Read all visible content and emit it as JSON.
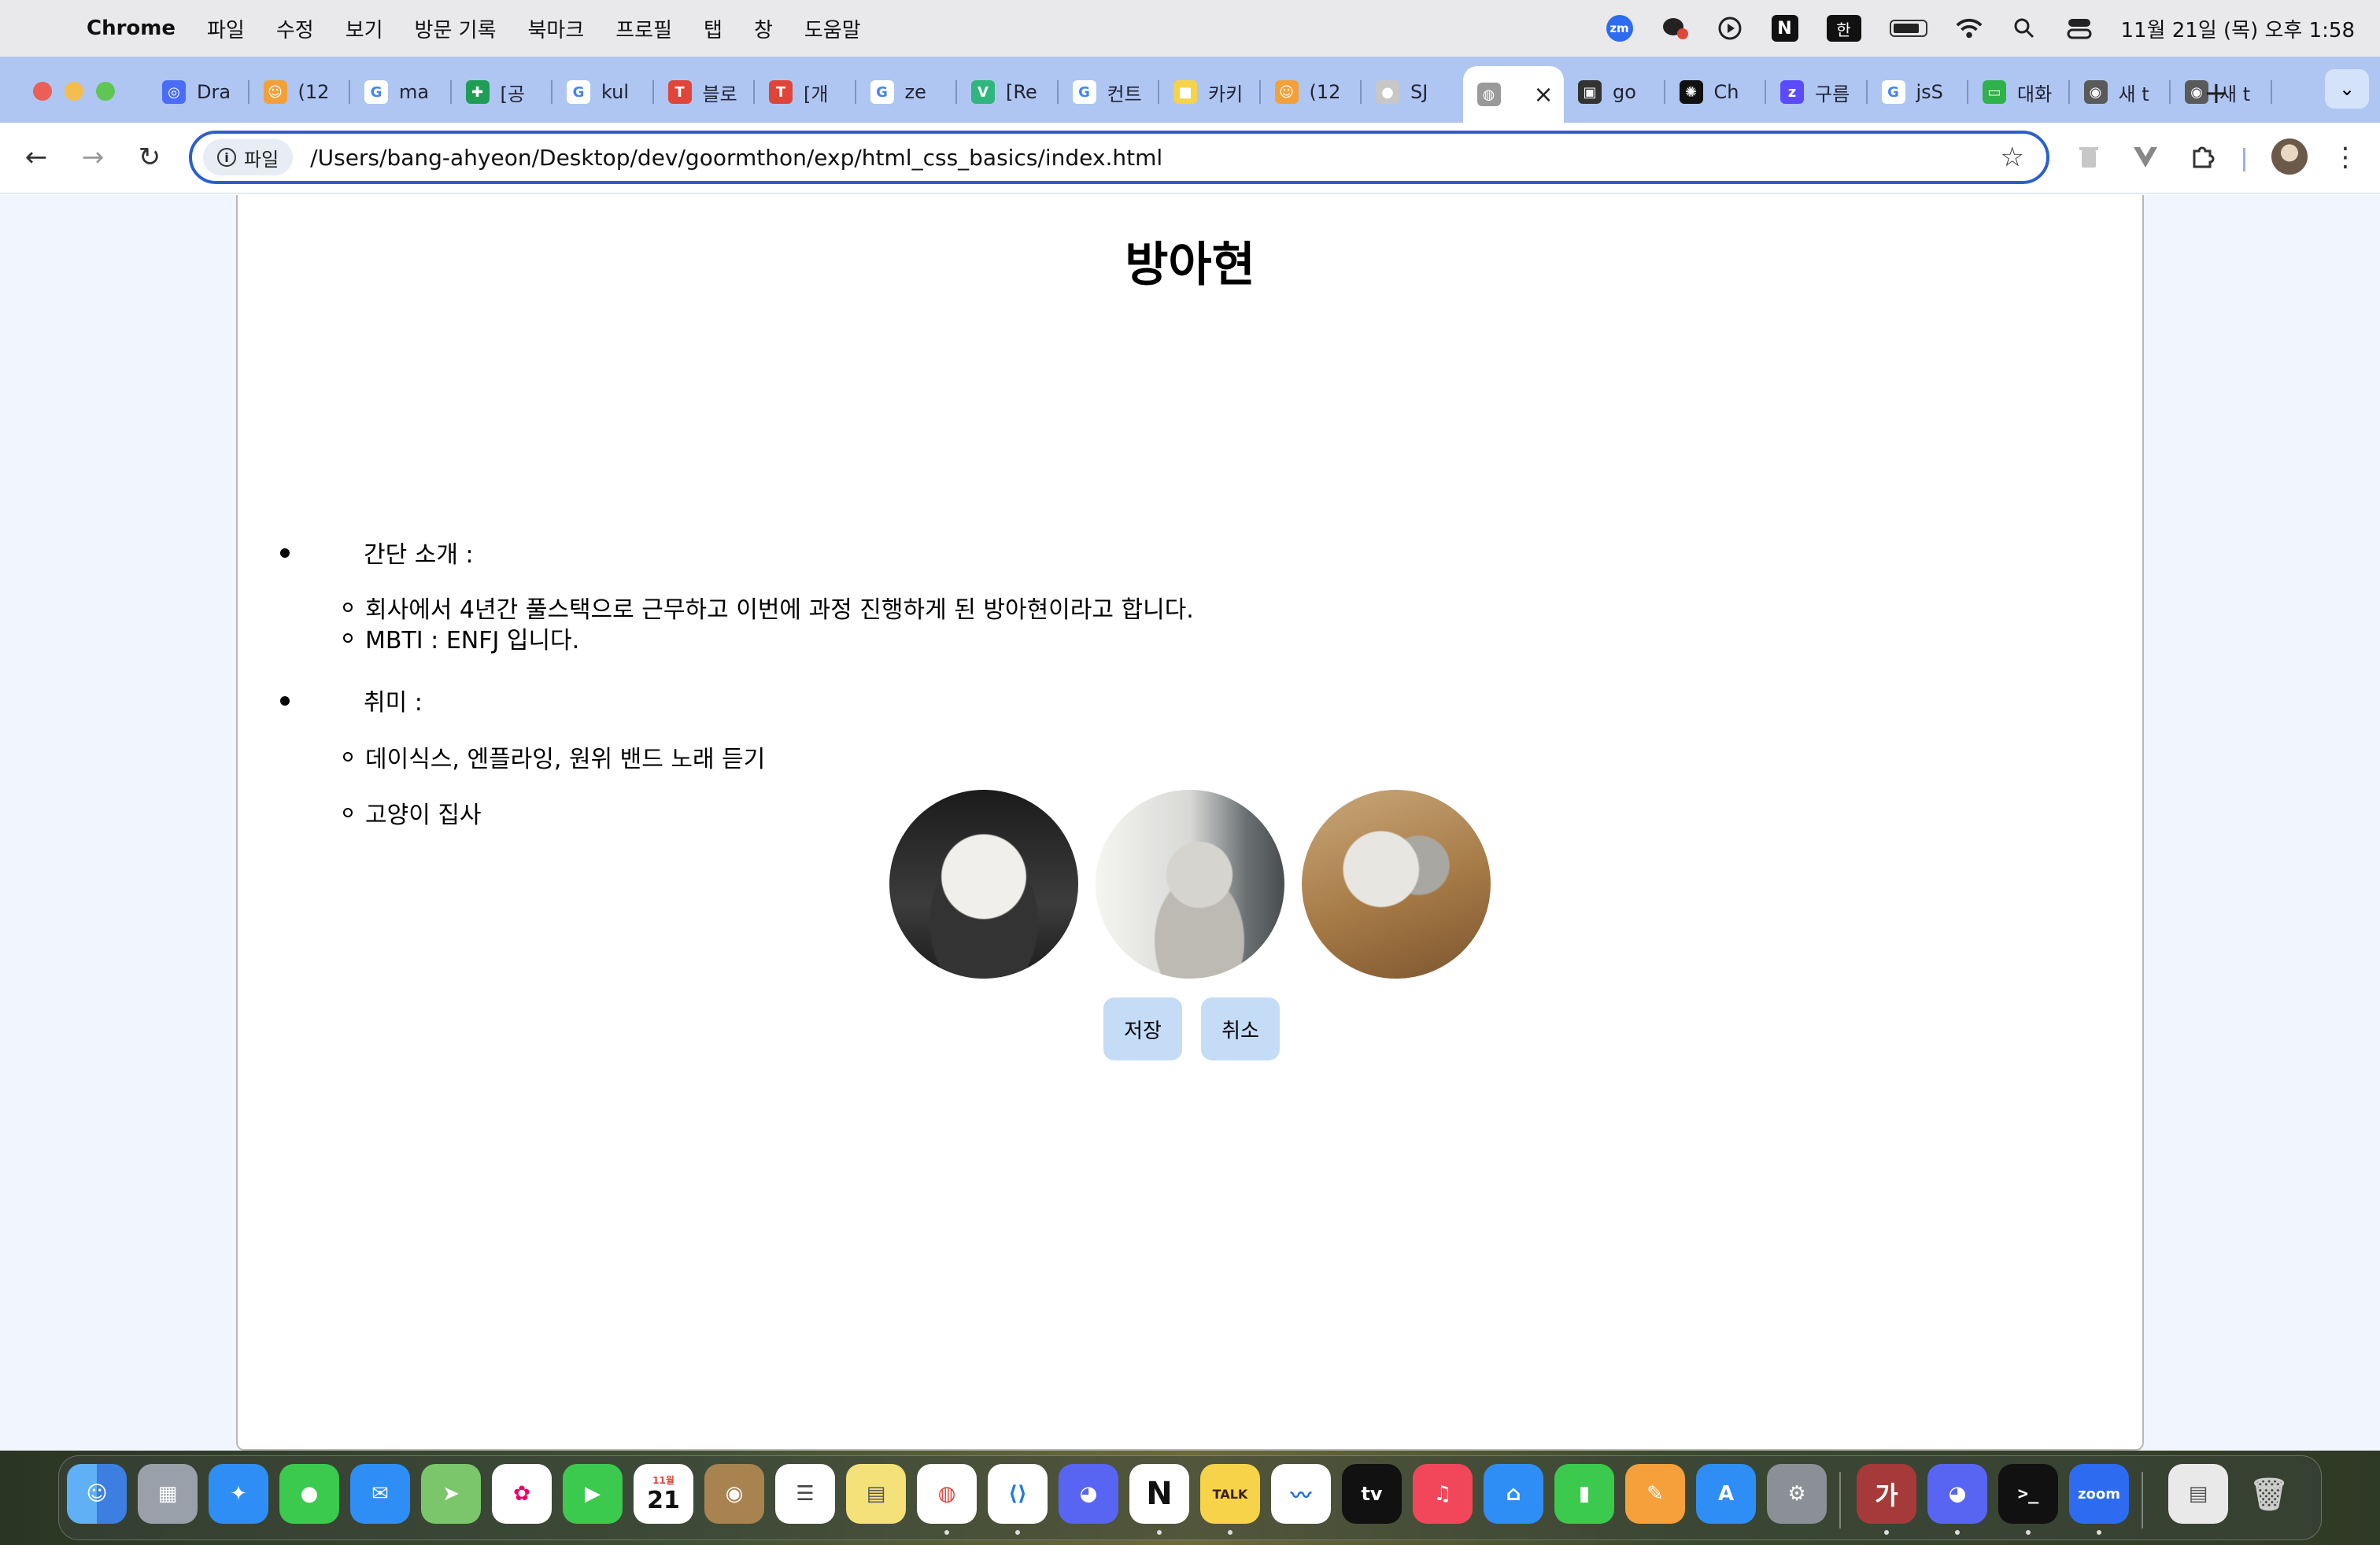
{
  "menubar": {
    "app_name": "Chrome",
    "items": [
      "파일",
      "수정",
      "보기",
      "방문 기록",
      "북마크",
      "프로필",
      "탭",
      "창",
      "도움말"
    ],
    "tray": {
      "zoom_label": "zm",
      "notion_label": "N",
      "input_label": "한"
    },
    "clock": "11월 21일 (목) 오후 1:58"
  },
  "tabs": [
    {
      "label": "Dra",
      "color": "#4a6cf7",
      "glyph": "◎"
    },
    {
      "label": "(12",
      "color": "#f2a13a",
      "glyph": "☺"
    },
    {
      "label": "ma",
      "color": "#ffffff",
      "glyph": "G"
    },
    {
      "label": "[공",
      "color": "#1f9d55",
      "glyph": "✚"
    },
    {
      "label": "kul",
      "color": "#ffffff",
      "glyph": "G"
    },
    {
      "label": "블로",
      "color": "#e0453a",
      "glyph": "T"
    },
    {
      "label": "[개",
      "color": "#e0453a",
      "glyph": "T"
    },
    {
      "label": "ze",
      "color": "#ffffff",
      "glyph": "G"
    },
    {
      "label": "[Re",
      "color": "#2eb67d",
      "glyph": "V"
    },
    {
      "label": "컨트",
      "color": "#ffffff",
      "glyph": "G"
    },
    {
      "label": "카키",
      "color": "#f7d34a",
      "glyph": "■"
    },
    {
      "label": "(12",
      "color": "#f2a13a",
      "glyph": "☺"
    },
    {
      "label": "SJ",
      "color": "#c7c7c7",
      "glyph": "●"
    },
    {
      "label": "",
      "color": "#9a9a9a",
      "glyph": "◍"
    },
    {
      "label": "go",
      "color": "#333333",
      "glyph": "▣"
    },
    {
      "label": "Ch",
      "color": "#111111",
      "glyph": "✺"
    },
    {
      "label": "구름",
      "color": "#5b4bff",
      "glyph": "z"
    },
    {
      "label": "jsS",
      "color": "#ffffff",
      "glyph": "G"
    },
    {
      "label": "대화",
      "color": "#2db34a",
      "glyph": "▭"
    },
    {
      "label": "새 t",
      "color": "#5a5a5a",
      "glyph": "◉"
    },
    {
      "label": "새 t",
      "color": "#5a5a5a",
      "glyph": "◉"
    }
  ],
  "toolbar": {
    "chip_label": "파일",
    "url": "/Users/bang-ahyeon/Desktop/dev/goormthon/exp/html_css_basics/index.html"
  },
  "page": {
    "title": "방아현",
    "intro_label": "간단 소개 :",
    "intro_items": [
      "회사에서 4년간 풀스택으로 근무하고 이번에 과정 진행하게 된 방아현이라고 합니다.",
      "MBTI : ENFJ 입니다."
    ],
    "hobby_label": "취미 :",
    "hobby_items": [
      "데이식스, 엔플라잉, 원위 밴드 노래 듣기",
      "고양이 집사"
    ],
    "save_label": "저장",
    "cancel_label": "취소"
  },
  "dock": {
    "calendar_month": "11월",
    "calendar_day": "21",
    "kakao_label": "TALK",
    "tv_label": "tv",
    "zoom_label": "zoom",
    "ga_label": "가"
  }
}
